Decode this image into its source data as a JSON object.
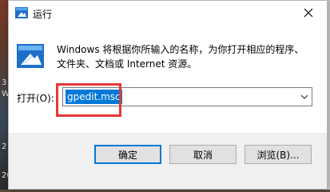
{
  "window": {
    "title": "运行",
    "close_icon": "close-icon"
  },
  "description": {
    "line1": "Windows 将根据你所输入的名称，为你打开相应的程序、",
    "line2": "文件夹、文档或 Internet 资源。"
  },
  "open": {
    "label": "打开(O):",
    "value": "gpedit.msc"
  },
  "buttons": {
    "ok": "确定",
    "cancel": "取消",
    "browse": "浏览(B)..."
  },
  "desktop": {
    "fragments": [
      "3",
      "W",
      "2",
      "20"
    ]
  },
  "colors": {
    "accent": "#0078d7",
    "highlight": "#e53935"
  }
}
